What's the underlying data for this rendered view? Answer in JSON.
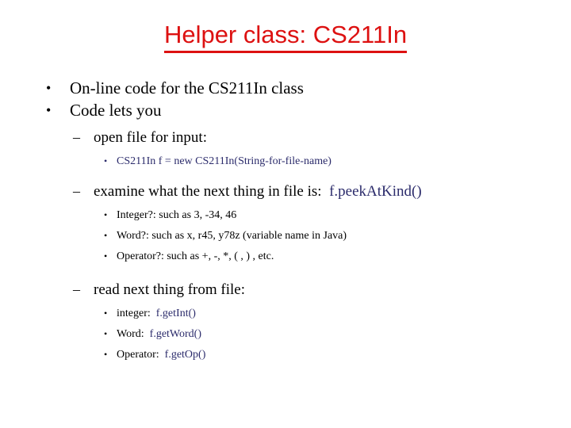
{
  "slide": {
    "title": "Helper class: CS211In",
    "title_color": "#dd1111",
    "code_color": "#2b2b6b",
    "text_color": "#000000",
    "background": "#ffffff",
    "bullet_glyphs": {
      "level1": "•",
      "level2": "–",
      "level3": "•"
    },
    "outline": {
      "l1_item1": "On-line code for the CS211In class",
      "l1_item2": "Code lets you",
      "l2_item1": "open file for input:",
      "l3_item1_code": "CS211In f  =  new CS211In(String-for-file-name)",
      "l2_item2_text": "examine what the next thing in file is:",
      "l2_item2_code": "f.peekAtKind()",
      "l3_item2": "Integer?: such as 3, -34, 46",
      "l3_item3": "Word?: such as x, r45, y78z (variable name in Java)",
      "l3_item4": "Operator?: such as +, -, *, ( , ) , etc.",
      "l2_item3": "read next thing from file:",
      "l3_item5_label": "integer:",
      "l3_item5_code": "f.getInt()",
      "l3_item6_label": "Word:",
      "l3_item6_code": "f.getWord()",
      "l3_item7_label": "Operator:",
      "l3_item7_code": "f.getOp()"
    }
  }
}
